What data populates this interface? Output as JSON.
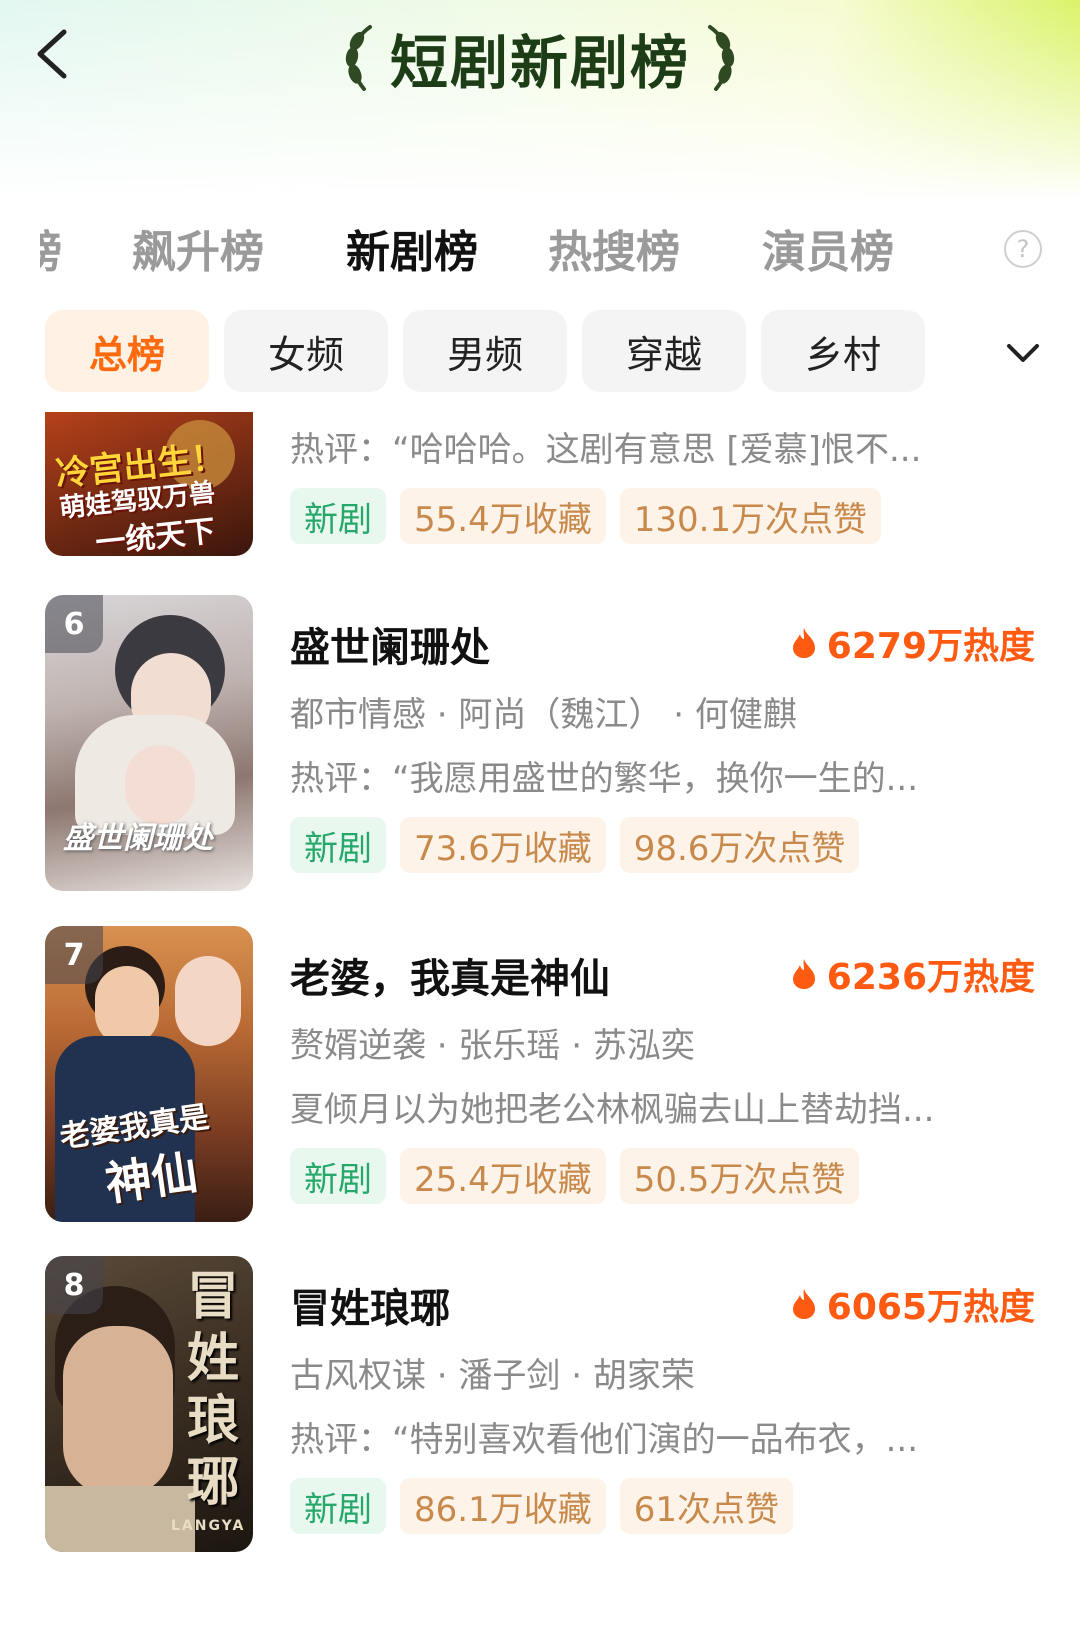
{
  "header": {
    "title": "短剧新剧榜"
  },
  "rank_tabs": [
    "榜",
    "飙升榜",
    "新剧榜",
    "热搜榜",
    "演员榜"
  ],
  "rank_tab_active": "新剧榜",
  "help_icon": "help-icon",
  "categories": [
    "总榜",
    "女频",
    "男频",
    "穿越",
    "乡村"
  ],
  "category_active": "总榜",
  "items": [
    {
      "review": "热评：“哈哈哈。这剧有意思 [爱慕]恨不...",
      "tags": [
        "新剧",
        "55.4万收藏",
        "130.1万次点赞"
      ],
      "poster_text": [
        "冷宫出生！",
        "萌娃驾驭万兽",
        "一统天下"
      ]
    },
    {
      "rank": "6",
      "title": "盛世阑珊处",
      "heat": "6279万热度",
      "meta": "都市情感 · 阿尚（魏江） · 何健麒",
      "review": "热评：“我愿用盛世的繁华，换你一生的...",
      "tags": [
        "新剧",
        "73.6万收藏",
        "98.6万次点赞"
      ],
      "poster_text": [
        "盛世阑珊处"
      ]
    },
    {
      "rank": "7",
      "title": "老婆，我真是神仙",
      "heat": "6236万热度",
      "meta": "赘婿逆袭 · 张乐瑶 · 苏泓奕",
      "review": "夏倾月以为她把老公林枫骗去山上替劫挡...",
      "tags": [
        "新剧",
        "25.4万收藏",
        "50.5万次点赞"
      ],
      "poster_text": [
        "老婆我真是",
        "神仙"
      ]
    },
    {
      "rank": "8",
      "title": "冒姓琅琊",
      "heat": "6065万热度",
      "meta": "古风权谋 · 潘子剑 · 胡家荣",
      "review": "热评：“特别喜欢看他们演的一品布衣，...",
      "tags": [
        "新剧",
        "86.1万收藏",
        "61次点赞"
      ],
      "poster_text": [
        "冒姓琅琊",
        "LANGYA"
      ]
    }
  ],
  "colors": {
    "accent": "#ff6a0f",
    "heat": "#ff5a12",
    "new_tag_text": "#27a86b",
    "stat_tag_text": "#c88a4c",
    "title_green": "#1d3d16"
  }
}
